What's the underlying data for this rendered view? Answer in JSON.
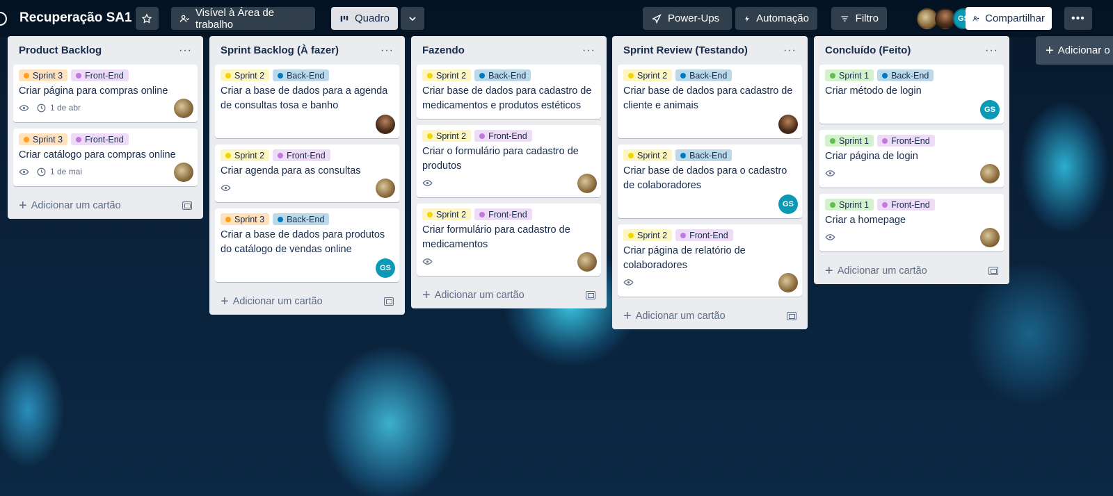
{
  "header": {
    "board_title": "Recuperação SA1",
    "visibility_label": "Visível à Área de trabalho",
    "view_label": "Quadro",
    "powerups_label": "Power-Ups",
    "automation_label": "Automação",
    "filter_label": "Filtro",
    "share_label": "Compartilhar",
    "member_initials": "GS"
  },
  "colors": {
    "sprint1": "#61bd4f",
    "sprint1_bg": "#d3f1cd",
    "sprint2": "#f2d600",
    "sprint2_bg": "#fdf6c1",
    "sprint3": "#ff9f1a",
    "sprint3_bg": "#ffe2bd",
    "frontend": "#c377e0",
    "frontend_bg": "#eedbf6",
    "backend": "#0079bf",
    "backend_bg": "#bcd9ea"
  },
  "lists": [
    {
      "title": "Product Backlog",
      "add_label": "Adicionar um cartão",
      "cards": [
        {
          "labels": [
            {
              "text": "Sprint 3",
              "kind": "sprint3"
            },
            {
              "text": "Front-End",
              "kind": "frontend"
            }
          ],
          "title": "Criar página para compras online",
          "watch": true,
          "date": "1 de abr",
          "avatar": "photo1"
        },
        {
          "labels": [
            {
              "text": "Sprint 3",
              "kind": "sprint3"
            },
            {
              "text": "Front-End",
              "kind": "frontend"
            }
          ],
          "title": "Criar catálogo para compras online",
          "watch": true,
          "date": "1 de mai",
          "avatar": "photo1"
        }
      ]
    },
    {
      "title": "Sprint Backlog (À fazer)",
      "add_label": "Adicionar um cartão",
      "cards": [
        {
          "labels": [
            {
              "text": "Sprint 2",
              "kind": "sprint2"
            },
            {
              "text": "Back-End",
              "kind": "backend"
            }
          ],
          "title": "Criar a base de dados para a agenda de consultas tosa e banho",
          "watch": false,
          "date": "",
          "avatar": "photo2"
        },
        {
          "labels": [
            {
              "text": "Sprint 2",
              "kind": "sprint2"
            },
            {
              "text": "Front-End",
              "kind": "frontend"
            }
          ],
          "title": "Criar agenda para as consultas",
          "watch": true,
          "date": "",
          "avatar": "photo1"
        },
        {
          "labels": [
            {
              "text": "Sprint 3",
              "kind": "sprint3"
            },
            {
              "text": "Back-End",
              "kind": "backend"
            }
          ],
          "title": "Criar a base de dados para produtos do catálogo de vendas online",
          "watch": false,
          "date": "",
          "avatar": "gs"
        }
      ]
    },
    {
      "title": "Fazendo",
      "add_label": "Adicionar um cartão",
      "cards": [
        {
          "labels": [
            {
              "text": "Sprint 2",
              "kind": "sprint2"
            },
            {
              "text": "Back-End",
              "kind": "backend"
            }
          ],
          "title": "Criar base de dados para cadastro de medicamentos e produtos estéticos",
          "watch": false,
          "date": "",
          "avatar": ""
        },
        {
          "labels": [
            {
              "text": "Sprint 2",
              "kind": "sprint2"
            },
            {
              "text": "Front-End",
              "kind": "frontend"
            }
          ],
          "title": "Criar o formulário para cadastro de produtos",
          "watch": true,
          "date": "",
          "avatar": "photo1"
        },
        {
          "labels": [
            {
              "text": "Sprint 2",
              "kind": "sprint2"
            },
            {
              "text": "Front-End",
              "kind": "frontend"
            }
          ],
          "title": "Criar formulário para cadastro de medicamentos",
          "watch": true,
          "date": "",
          "avatar": "photo1"
        }
      ]
    },
    {
      "title": "Sprint Review (Testando)",
      "add_label": "Adicionar um cartão",
      "cards": [
        {
          "labels": [
            {
              "text": "Sprint 2",
              "kind": "sprint2"
            },
            {
              "text": "Back-End",
              "kind": "backend"
            }
          ],
          "title": "Criar base de dados para cadastro de cliente e animais",
          "watch": false,
          "date": "",
          "avatar": "photo2"
        },
        {
          "labels": [
            {
              "text": "Sprint 2",
              "kind": "sprint2"
            },
            {
              "text": "Back-End",
              "kind": "backend"
            }
          ],
          "title": "Criar base de dados para o cadastro de colaboradores",
          "watch": false,
          "date": "",
          "avatar": "gs"
        },
        {
          "labels": [
            {
              "text": "Sprint 2",
              "kind": "sprint2"
            },
            {
              "text": "Front-End",
              "kind": "frontend"
            }
          ],
          "title": "Criar página de relatório de colaboradores",
          "watch": true,
          "date": "",
          "avatar": "photo1"
        }
      ]
    },
    {
      "title": "Concluído (Feito)",
      "add_label": "Adicionar um cartão",
      "cards": [
        {
          "labels": [
            {
              "text": "Sprint 1",
              "kind": "sprint1"
            },
            {
              "text": "Back-End",
              "kind": "backend"
            }
          ],
          "title": "Criar método de login",
          "watch": false,
          "date": "",
          "avatar": "gs"
        },
        {
          "labels": [
            {
              "text": "Sprint 1",
              "kind": "sprint1"
            },
            {
              "text": "Front-End",
              "kind": "frontend"
            }
          ],
          "title": "Criar página de login",
          "watch": true,
          "date": "",
          "avatar": "photo1"
        },
        {
          "labels": [
            {
              "text": "Sprint 1",
              "kind": "sprint1"
            },
            {
              "text": "Front-End",
              "kind": "frontend"
            }
          ],
          "title": "Criar a homepage",
          "watch": true,
          "date": "",
          "avatar": "photo1"
        }
      ]
    }
  ],
  "add_list_label": "Adicionar o"
}
